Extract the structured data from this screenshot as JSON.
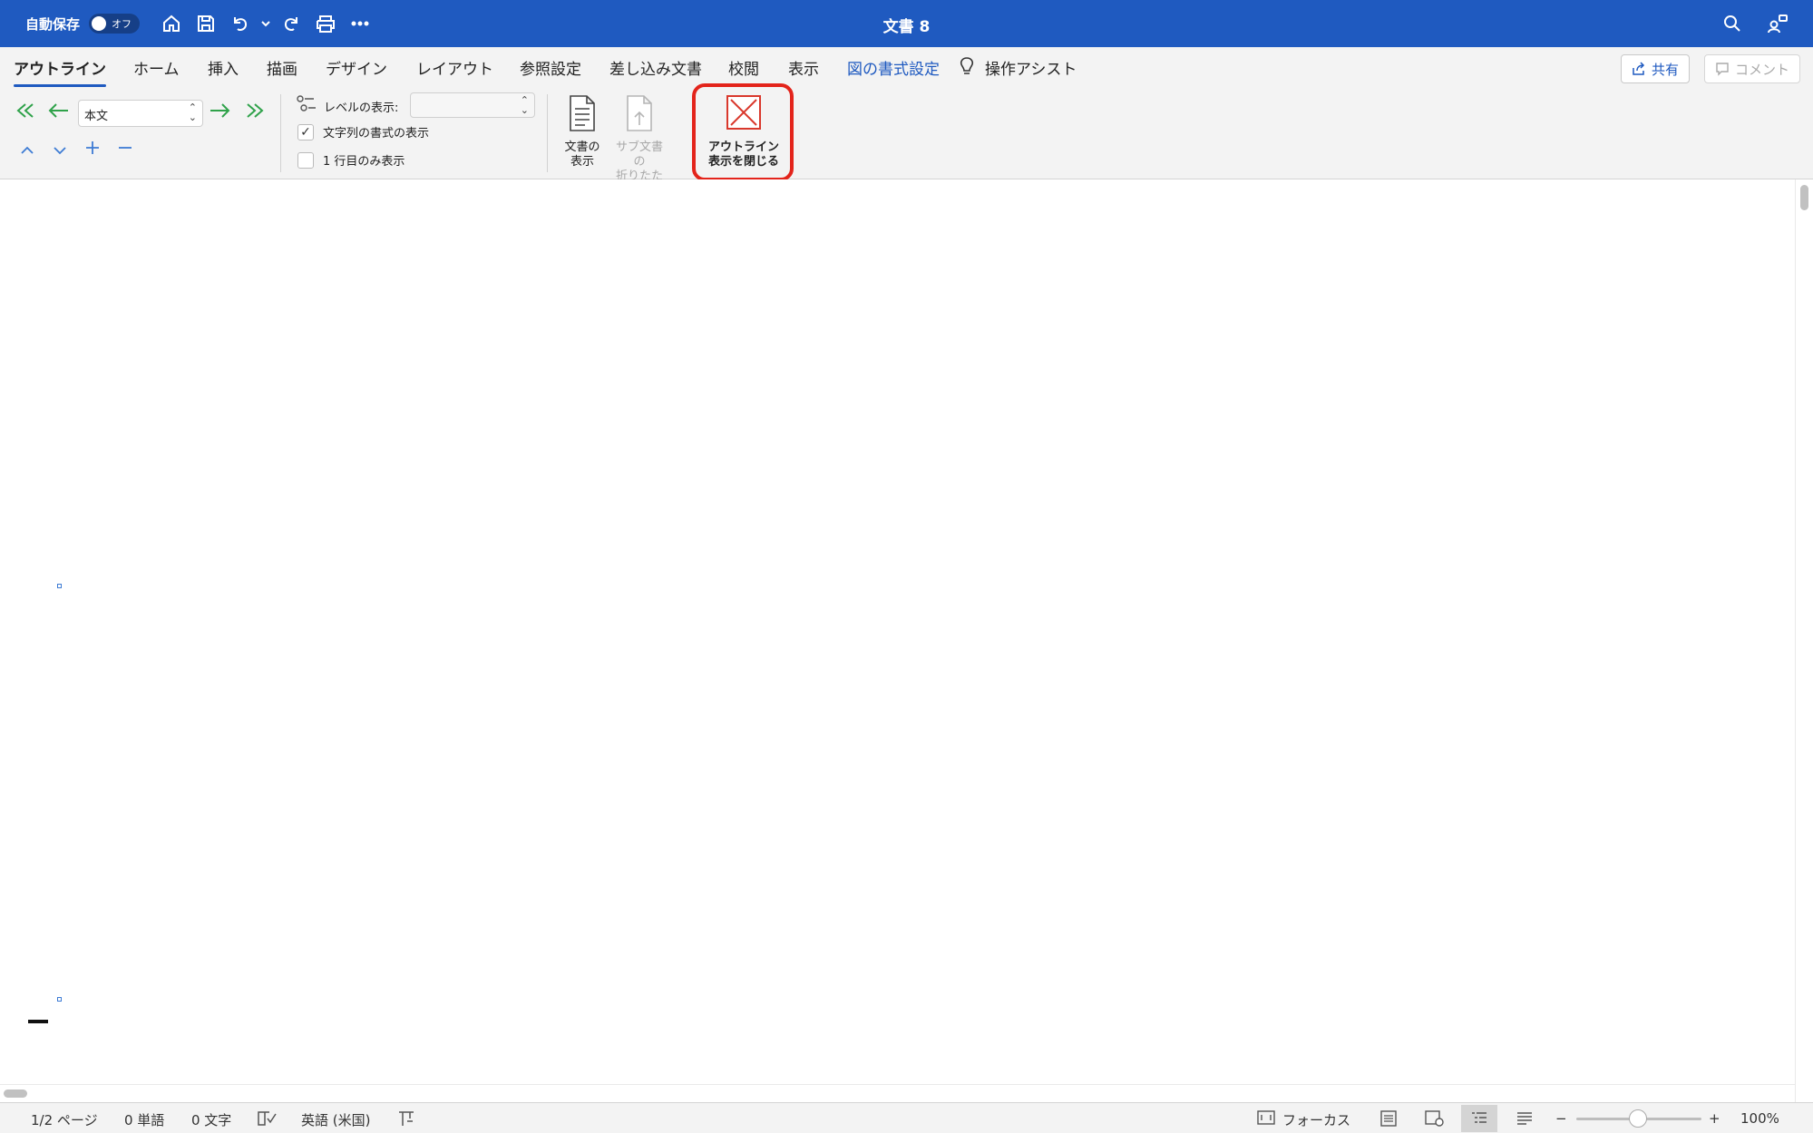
{
  "titlebar": {
    "autosave_label": "自動保存",
    "autosave_state": "オフ",
    "doc_title": "文書 8",
    "quick_access_icons": [
      "home-icon",
      "save-icon",
      "undo-icon",
      "redo-icon",
      "print-icon",
      "more-icon"
    ],
    "right_icons": [
      "search-icon",
      "account-icon"
    ],
    "bar_color": "#1f5ac0"
  },
  "tabs": [
    {
      "label": "アウトライン",
      "active": true
    },
    {
      "label": "ホーム"
    },
    {
      "label": "挿入"
    },
    {
      "label": "描画"
    },
    {
      "label": "デザイン"
    },
    {
      "label": "レイアウト"
    },
    {
      "label": "参照設定"
    },
    {
      "label": "差し込み文書"
    },
    {
      "label": "校閲"
    },
    {
      "label": "表示"
    },
    {
      "label": "図の書式設定",
      "accent": true
    }
  ],
  "assist_label": "操作アシスト",
  "share_label": "共有",
  "comment_label": "コメント",
  "ribbon": {
    "style_value": "本文",
    "level_label": "レベルの表示:",
    "level_value": "",
    "show_format_label": "文字列の書式の表示",
    "show_format_checked": true,
    "first_line_label": "1 行目のみ表示",
    "first_line_checked": false,
    "show_doc": {
      "line1": "文書の",
      "line2": "表示"
    },
    "collapse_sub": {
      "line1": "サブ文書の",
      "line2": "折りたたみ"
    },
    "close_outline": {
      "line1": "アウトライン",
      "line2": "表示を閉じる"
    },
    "highlight_color": "#e3241b"
  },
  "status": {
    "page": "1/2 ページ",
    "words": "0 単語",
    "chars": "0 文字",
    "language": "英語 (米国)",
    "focus_label": "フォーカス",
    "zoom_minus": "−",
    "zoom_plus": "+",
    "zoom": "100%",
    "zoom_fraction": 0.5
  }
}
